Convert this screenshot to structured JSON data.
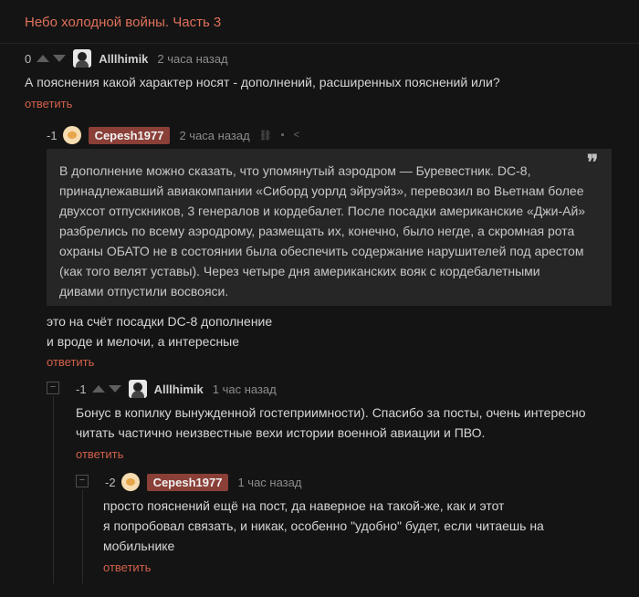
{
  "story": {
    "title": "Небо холодной войны. Часть 3"
  },
  "comments": [
    {
      "rating": "0",
      "user": "Alllhimik",
      "time": "2 часа назад",
      "lines": [
        "А пояснения какой характер носят - дополнений, расширенных пояснений или?"
      ],
      "reply": "ответить"
    },
    {
      "rating": "-1",
      "user": "Cepesh1977",
      "time": "2 часа назад",
      "quote": [
        "В дополнение можно сказать, что упомянутый аэродром — Буревестник. DC-8,",
        "принадлежавший авиакомпании «Сиборд уорлд эйруэйз», перевозил во Вьетнам более",
        "двухсот отпускников, 3 генералов и кордебалет. После посадки американские «Джи-Ай»",
        "разбрелись по всему аэродрому, размещать их, конечно, было негде, а скромная рота",
        "охраны ОБАТО не в состоянии была обеспечить содержание нарушителей под арестом",
        "(как того велят уставы). Через четыре дня американских вояк с кордебалетными",
        "дивами отпустили восвояси."
      ],
      "lines": [
        "это на счёт посадки DC-8 дополнение",
        "и вроде и мелочи, а интересные"
      ],
      "reply": "ответить"
    },
    {
      "rating": "-1",
      "user": "Alllhimik",
      "time": "1 час назад",
      "lines": [
        "Бонус в копилку вынужденной гостеприимности). Спасибо за посты, очень интересно",
        "читать частично неизвестные вехи истории военной авиации и ПВО."
      ],
      "reply": "ответить"
    },
    {
      "rating": "-2",
      "user": "Cepesh1977",
      "time": "1 час назад",
      "lines": [
        "просто пояснений ещё на пост, да наверное на такой-же, как и этот",
        "я попробовал связать, и никак, особенно \"удобно\" будет, если читаешь на",
        "мобильнике"
      ],
      "reply": "ответить"
    }
  ],
  "icons": {
    "collapse": "−",
    "quote": "❜❜",
    "link": "⛓",
    "save": "▪",
    "share": "<"
  }
}
